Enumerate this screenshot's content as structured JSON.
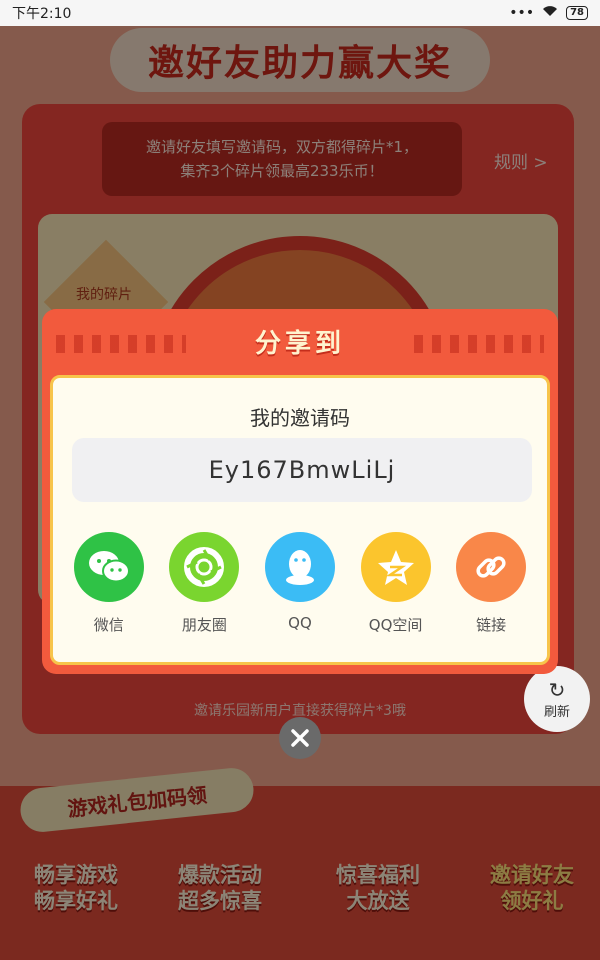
{
  "status_bar": {
    "time": "下午2:10",
    "battery": "78"
  },
  "background": {
    "banner_title": "邀好友助力赢大奖",
    "tip_line1": "邀请好友填写邀请码，双方都得碎片*1，",
    "tip_line2": "集齐3个碎片领最高233乐币！",
    "rules": "规则 >",
    "fragment_label": "我的碎片",
    "bottom_hint": "邀请乐园新用户直接获得碎片*3哦",
    "refresh_label": "刷新",
    "gift_banner": "游戏礼包加码领",
    "promos": [
      {
        "line1": "畅享游戏",
        "line2": "畅享好礼"
      },
      {
        "line1": "爆款活动",
        "line2": "超多惊喜"
      },
      {
        "line1": "惊喜福利",
        "line2": "大放送"
      },
      {
        "line1": "邀请好友",
        "line2": "领好礼"
      }
    ]
  },
  "modal": {
    "title": "分享到",
    "invite_label": "我的邀请码",
    "invite_code": "Ey167BmwLiLj",
    "share_targets": [
      {
        "label": "微信",
        "icon": "wechat-icon",
        "color": "#2fc246"
      },
      {
        "label": "朋友圈",
        "icon": "moments-icon",
        "color": "#7ad52f"
      },
      {
        "label": "QQ",
        "icon": "qq-icon",
        "color": "#3bbcf5"
      },
      {
        "label": "QQ空间",
        "icon": "qzone-icon",
        "color": "#fbc52d"
      },
      {
        "label": "链接",
        "icon": "link-icon",
        "color": "#f98749"
      }
    ]
  },
  "colors": {
    "accent": "#f25a3d",
    "modal_body": "#fffcef",
    "border_gold": "#f7c44a"
  }
}
